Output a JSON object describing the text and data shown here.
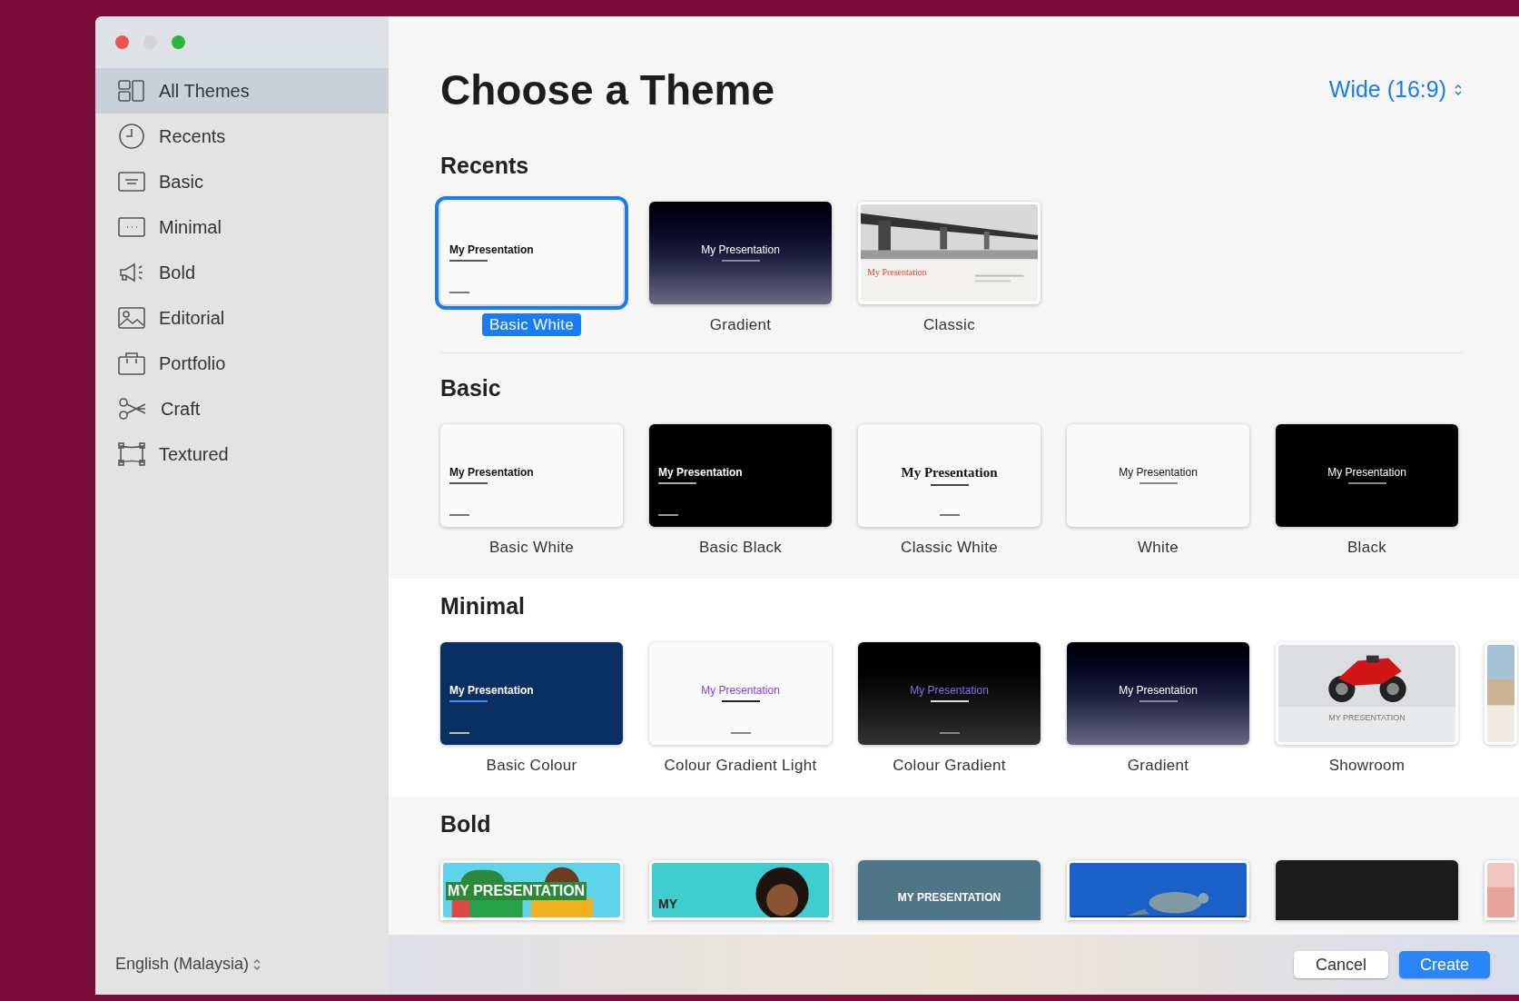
{
  "sidebar": {
    "items": [
      {
        "label": "All Themes",
        "selected": true
      },
      {
        "label": "Recents",
        "selected": false
      },
      {
        "label": "Basic",
        "selected": false
      },
      {
        "label": "Minimal",
        "selected": false
      },
      {
        "label": "Bold",
        "selected": false
      },
      {
        "label": "Editorial",
        "selected": false
      },
      {
        "label": "Portfolio",
        "selected": false
      },
      {
        "label": "Craft",
        "selected": false
      },
      {
        "label": "Textured",
        "selected": false
      }
    ],
    "language": "English (Malaysia)"
  },
  "header": {
    "title": "Choose a Theme",
    "slide_size": "Wide (16:9)"
  },
  "sections": [
    {
      "heading": "Recents",
      "themes": [
        {
          "name": "Basic White",
          "title": "My Presentation",
          "kind": "white",
          "selected": true
        },
        {
          "name": "Gradient",
          "title": "My Presentation",
          "kind": "gradient",
          "selected": false
        },
        {
          "name": "Classic",
          "title": "My Presentation",
          "kind": "bridge",
          "selected": false
        }
      ]
    },
    {
      "heading": "Basic",
      "themes": [
        {
          "name": "Basic White",
          "title": "My Presentation",
          "kind": "white",
          "selected": false
        },
        {
          "name": "Basic Black",
          "title": "My Presentation",
          "kind": "black",
          "selected": false
        },
        {
          "name": "Classic White",
          "title": "My Presentation",
          "kind": "classic",
          "selected": false
        },
        {
          "name": "White",
          "title": "My Presentation",
          "kind": "white-center",
          "selected": false
        },
        {
          "name": "Black",
          "title": "My Presentation",
          "kind": "black-center",
          "selected": false
        }
      ]
    },
    {
      "heading": "Minimal",
      "themes": [
        {
          "name": "Basic Colour",
          "title": "My Presentation",
          "kind": "navy",
          "selected": false
        },
        {
          "name": "Colour Gradient Light",
          "title": "My Presentation",
          "kind": "colour-light",
          "selected": false
        },
        {
          "name": "Colour Gradient",
          "title": "My Presentation",
          "kind": "colour-dark",
          "selected": false
        },
        {
          "name": "Gradient",
          "title": "My Presentation",
          "kind": "gradient",
          "selected": false
        },
        {
          "name": "Showroom",
          "title": "MY PRESENTATION",
          "kind": "bike",
          "selected": false
        },
        {
          "kind": "sliver-sand",
          "selected": false
        }
      ]
    },
    {
      "heading": "Bold",
      "themes": [
        {
          "title": "MY PRESENTATION",
          "kind": "people",
          "selected": false
        },
        {
          "title": "MY",
          "kind": "person",
          "selected": false
        },
        {
          "title": "MY PRESENTATION",
          "kind": "slate",
          "selected": false
        },
        {
          "kind": "ocean",
          "selected": false
        },
        {
          "kind": "dark",
          "selected": false
        },
        {
          "kind": "sliver-pink",
          "selected": false
        }
      ]
    }
  ],
  "buttons": [
    {
      "label": "Cancel",
      "kind": "secondary"
    },
    {
      "label": "Create",
      "kind": "primary"
    }
  ]
}
